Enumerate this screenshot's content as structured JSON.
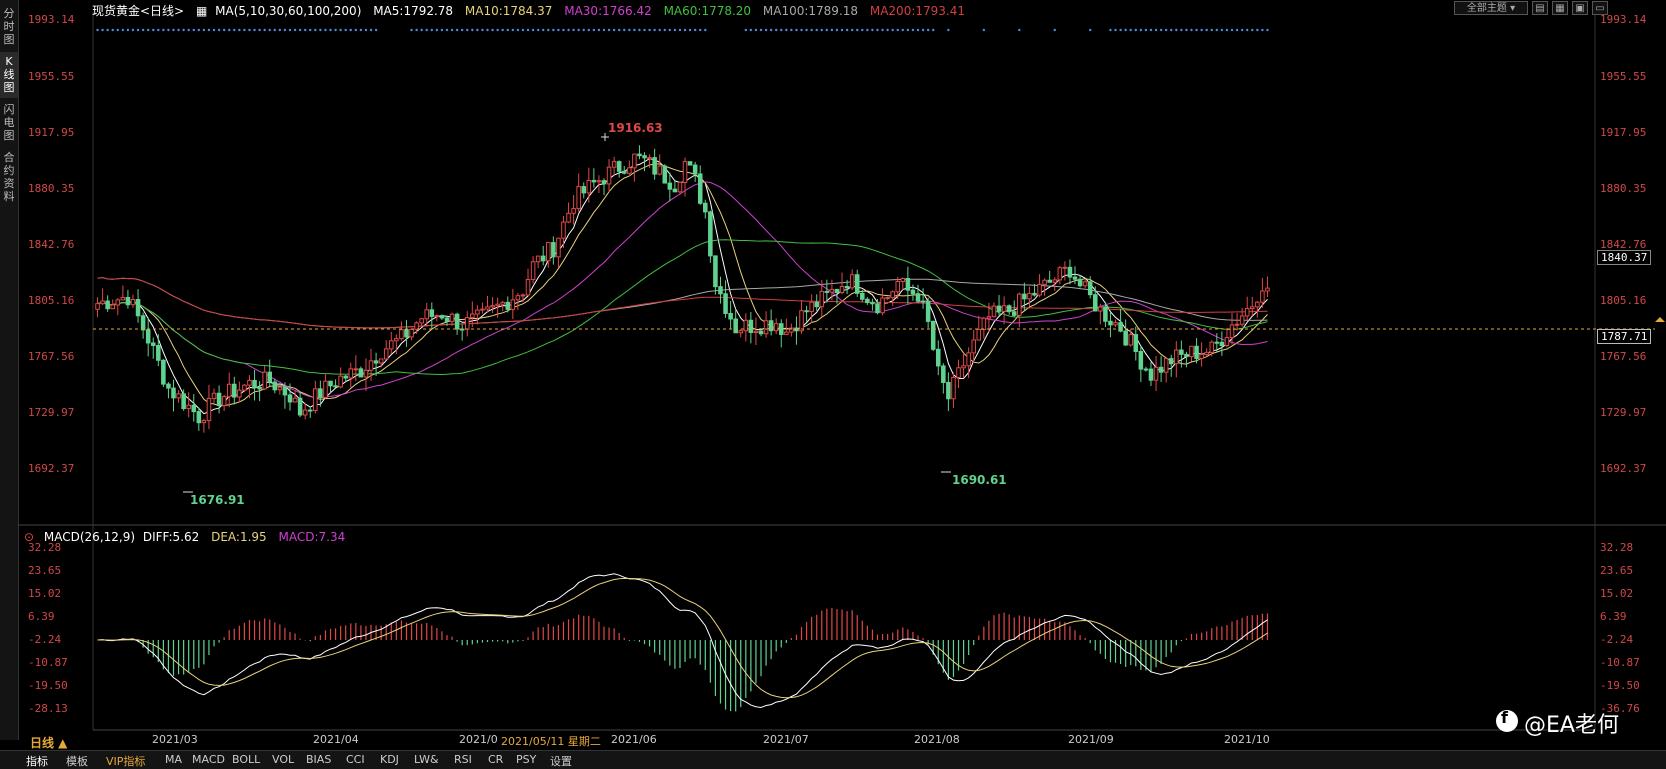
{
  "sidebar": {
    "tabs": [
      {
        "label": "分时图",
        "active": false
      },
      {
        "label": "K线图",
        "active": true
      },
      {
        "label": "闪电图",
        "active": false
      },
      {
        "label": "合约资料",
        "active": false
      }
    ]
  },
  "legend": {
    "title": "现货黄金<日线>",
    "ma_params": "MA(5,10,30,60,100,200)",
    "ma5": "MA5:1792.78",
    "ma10": "MA10:1784.37",
    "ma30": "MA30:1766.42",
    "ma60": "MA60:1778.20",
    "ma100": "MA100:1789.18",
    "ma200": "MA200:1793.41"
  },
  "macd_legend": {
    "params": "MACD(26,12,9)",
    "diff": "DIFF:5.62",
    "dea": "DEA:1.95",
    "macd": "MACD:7.34"
  },
  "toolbar": {
    "theme_label": "全部主题"
  },
  "price_axis": {
    "labels": [
      "1993.14",
      "1955.55",
      "1917.95",
      "1880.35",
      "1842.76",
      "1805.16",
      "1767.56",
      "1729.97",
      "1692.37"
    ],
    "current_price": "1787.71",
    "hover_price": "1840.37"
  },
  "macd_axis": {
    "labels": [
      "32.28",
      "23.65",
      "15.02",
      "6.39",
      "-2.24",
      "-10.87",
      "-19.50",
      "-28.13"
    ],
    "right_bottom": "-36.76"
  },
  "annotations": {
    "high": "1916.63",
    "low1": "1676.91",
    "low2": "1690.61"
  },
  "x_axis": {
    "labels": [
      "2021/03",
      "2021/04",
      "2021/0",
      "2021/06",
      "2021/07",
      "2021/08",
      "2021/09",
      "2021/10"
    ],
    "crosshair_date": "2021/05/11 星期二"
  },
  "period_label": "日线 ▲",
  "bottom_tabs": [
    "指标",
    "模板",
    "VIP指标",
    "MA",
    "MACD",
    "BOLL",
    "VOL",
    "BIAS",
    "CCI",
    "KDJ",
    "LW&",
    "RSI",
    "CR",
    "PSY",
    "设置"
  ],
  "watermark": "@EA老何",
  "colors": {
    "up": "#e04848",
    "down": "#5fd38f",
    "ma5": "#ffffff",
    "ma10": "#e8d27a",
    "ma30": "#d040d0",
    "ma60": "#40c040",
    "ma100": "#a8a8a8",
    "ma200": "#d04040",
    "diff": "#ffffff",
    "dea": "#e8d27a"
  },
  "chart_data": [
    {
      "type": "candlestick",
      "title": "现货黄金<日线>",
      "y_range": [
        1676.91,
        1993.14
      ],
      "current_price": 1787.71,
      "high_marker": 1916.63,
      "low_markers": [
        1676.91,
        1690.61
      ],
      "series": [
        {
          "name": "MA5",
          "value": 1792.78
        },
        {
          "name": "MA10",
          "value": 1784.37
        },
        {
          "name": "MA30",
          "value": 1766.42
        },
        {
          "name": "MA60",
          "value": 1778.2
        },
        {
          "name": "MA100",
          "value": 1789.18
        },
        {
          "name": "MA200",
          "value": 1793.41
        }
      ],
      "x_ticks": [
        "2021/03",
        "2021/04",
        "2021/06",
        "2021/07",
        "2021/08",
        "2021/09",
        "2021/10"
      ]
    },
    {
      "type": "bar",
      "title": "MACD(26,12,9)",
      "series": [
        {
          "name": "DIFF",
          "value": 5.62
        },
        {
          "name": "DEA",
          "value": 1.95
        },
        {
          "name": "MACD",
          "value": 7.34
        }
      ],
      "y_ticks": [
        32.28,
        23.65,
        15.02,
        6.39,
        -2.24,
        -10.87,
        -19.5,
        -28.13
      ]
    }
  ]
}
